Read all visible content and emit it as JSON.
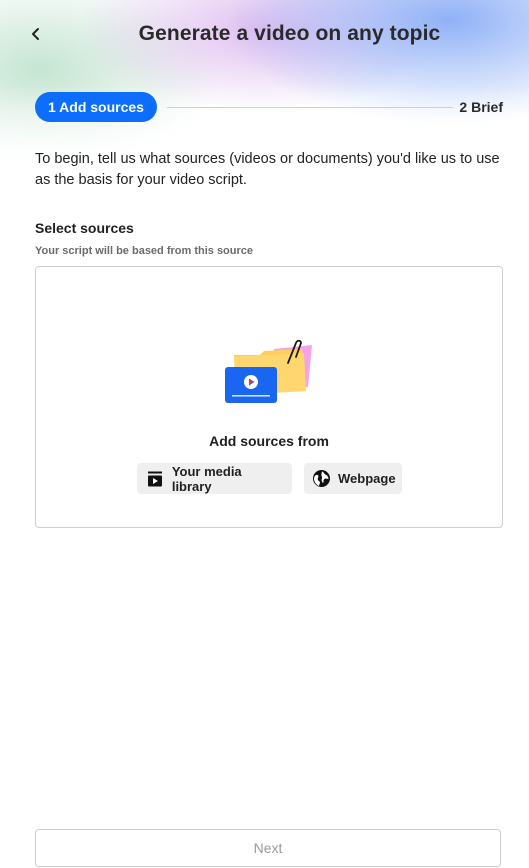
{
  "header": {
    "title": "Generate a video on any topic",
    "back_icon": "chevron-left-icon"
  },
  "stepper": {
    "steps": [
      {
        "label": "1 Add sources",
        "active": true
      },
      {
        "label": "2 Brief",
        "active": false
      }
    ],
    "active_color": "#0d6efd"
  },
  "intro": {
    "text": "To begin, tell us what sources (videos or documents) you'd like us to use as the basis for your video script."
  },
  "sources": {
    "title": "Select sources",
    "subtitle": "Your script will be based from this source",
    "add_from_label": "Add sources from",
    "illustration": "folder-video-illustration",
    "options": [
      {
        "label": "Your media library",
        "icon": "media-library-icon"
      },
      {
        "label": "Webpage",
        "icon": "globe-icon"
      }
    ]
  },
  "footer": {
    "next_label": "Next"
  }
}
